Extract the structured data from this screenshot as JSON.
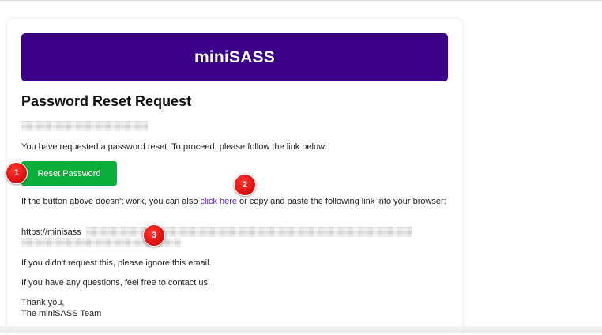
{
  "brand": {
    "title": "miniSASS"
  },
  "email": {
    "heading": "Password Reset Request",
    "intro": "You have requested a password reset. To proceed, please follow the link below:",
    "reset_button": "Reset Password",
    "fallback_prefix": "If the button above doesn't work, you can also ",
    "fallback_link": "click here",
    "fallback_suffix": " or copy and paste the following link into your browser:",
    "link_url_prefix": "https://minisass",
    "ignore_note": "If you didn't request this, please ignore this email.",
    "contact_note": "If you have any questions, feel free to contact us.",
    "signoff": "Thank you,",
    "signature": "The miniSASS Team"
  },
  "annotations": {
    "markers": [
      "1",
      "2",
      "3"
    ]
  },
  "colors": {
    "brand_header": "#3a0088",
    "button": "#0aae3a",
    "link": "#5b1fd6",
    "marker": "#e01010"
  }
}
